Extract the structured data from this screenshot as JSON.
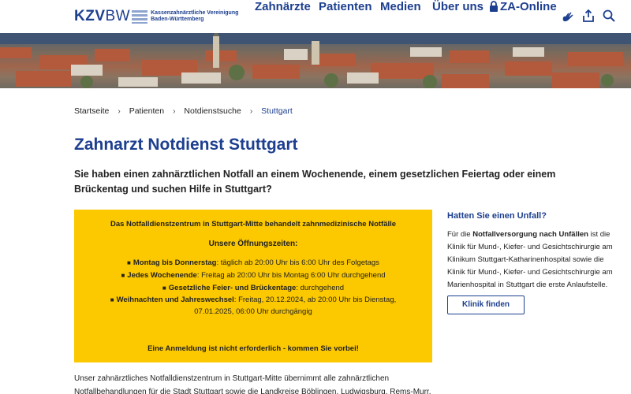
{
  "header": {
    "logo": {
      "main": "KZV",
      "bw": "BW",
      "sub_line1": "Kassenzahnärztliche Vereinigung",
      "sub_line2": "Baden-Württemberg"
    },
    "nav": [
      "Zahnärzte",
      "Patienten",
      "Medien",
      "Über uns",
      "ZA-Online"
    ],
    "icons": [
      "lock-icon",
      "sign-language-icon",
      "share-icon",
      "search-icon"
    ]
  },
  "breadcrumb": [
    "Startseite",
    "Patienten",
    "Notdienstsuche",
    "Stuttgart"
  ],
  "main": {
    "title": "Zahnarzt Notdienst Stuttgart",
    "lead": "Sie haben einen zahnärztlichen Notfall an einem Wochenende, einem gesetzlichen Feiertag oder einem Brückentag und suchen Hilfe in Stuttgart?",
    "infobox": {
      "intro": "Das Notfalldienstzentrum in Stuttgart-Mitte behandelt zahnmedizinische Notfälle",
      "hours_title": "Unsere Öffnungszeiten:",
      "row1_bold": "Montag bis Donnerstag",
      "row1_text": ": täglich ab 20:00 Uhr bis 6:00 Uhr des Folgetags",
      "row2_bold": "Jedes Wochenende",
      "row2_text": ": Freitag ab 20:00 Uhr bis Montag 6:00 Uhr durchgehend",
      "row3_bold": "Gesetzliche Feier- und Brückentage",
      "row3_text": ": durchgehend",
      "row4_bold": "Weihnachten und Jahreswechsel",
      "row4_text": ": Freitag, 20.12.2024, ab 20:00 Uhr bis Dienstag,",
      "row4_cont": "07.01.2025, 06:00 Uhr durchgängig",
      "note": "Eine Anmeldung ist nicht erforderlich - kommen Sie vorbei!"
    },
    "body_line1": "Unser zahnärztliches Notfalldienstzentrum in Stuttgart-Mitte übernimmt alle zahnärztlichen",
    "body_line2": "Notfallbehandlungen für die Stadt Stuttgart sowie die Landkreise Böblingen, Ludwigsburg, Rems-Murr,"
  },
  "side": {
    "title": "Hatten Sie einen Unfall?",
    "text_pre": "Für die ",
    "text_bold": "Notfallversorgung nach Unfällen",
    "text_post": " ist die Klinik für Mund-, Kiefer- und Gesichtschirurgie am Klinikum Stuttgart-Katharinenhospital sowie die Klinik für Mund-, Kiefer- und Gesichtschirurgie am Marienhospital in Stuttgart die erste Anlaufstelle.",
    "button": "Klinik finden"
  },
  "colors": {
    "brand_blue": "#1d3f8f",
    "highlight_yellow": "#fcc800"
  }
}
